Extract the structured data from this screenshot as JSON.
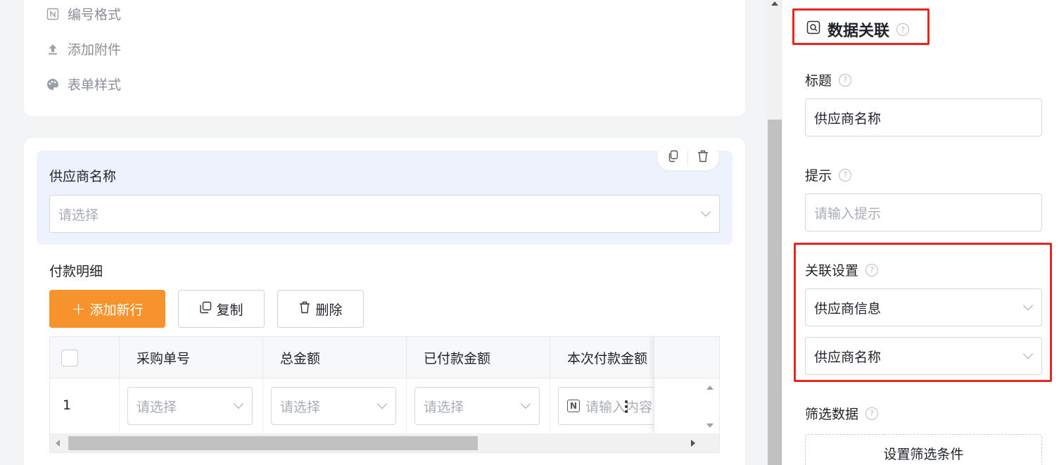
{
  "form_menu": {
    "number_format": "编号格式",
    "add_attachment": "添加附件",
    "form_style": "表单样式"
  },
  "field": {
    "label": "供应商名称",
    "placeholder": "请选择"
  },
  "subtable": {
    "title": "付款明细",
    "add_row_label": "添加新行",
    "copy_label": "复制",
    "delete_label": "删除",
    "columns": [
      "采购单号",
      "总金额",
      "已付款金额",
      "本次付款金额"
    ],
    "rows": [
      {
        "index": "1",
        "cells": [
          "请选择",
          "请选择",
          "请选择",
          "请输入内容"
        ]
      }
    ]
  },
  "panel": {
    "title": "数据关联",
    "title_label": "标题",
    "title_value": "供应商名称",
    "hint_label": "提示",
    "hint_placeholder": "请输入提示",
    "link_settings_label": "关联设置",
    "link_source": "供应商信息",
    "link_field": "供应商名称",
    "filter_label": "筛选数据",
    "filter_button": "设置筛选条件"
  },
  "colors": {
    "primary": "#f7932d",
    "highlight": "#e8251f",
    "field_bg": "#eef2fd"
  }
}
